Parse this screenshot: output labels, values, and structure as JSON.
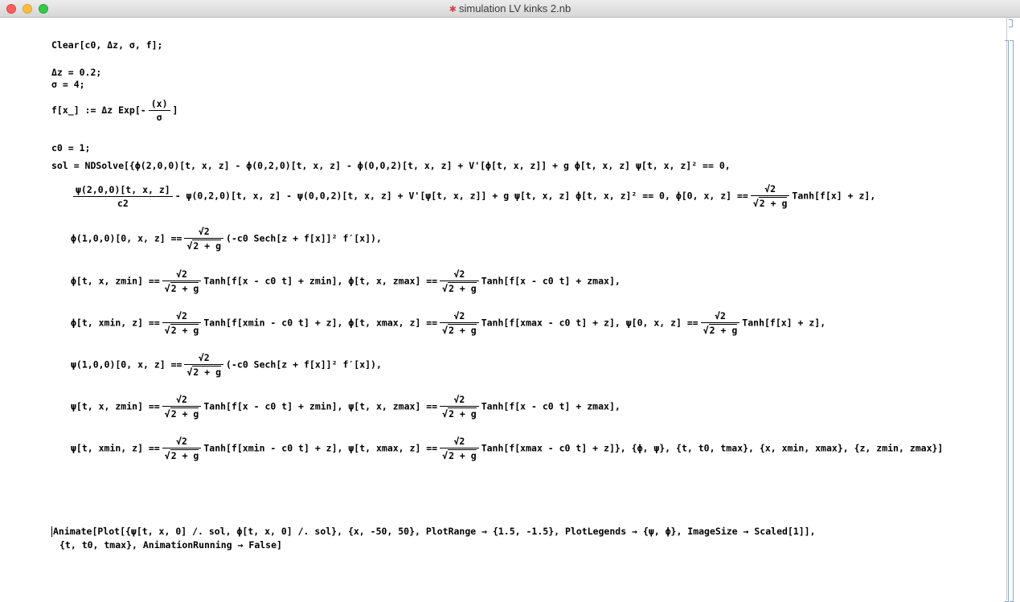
{
  "window": {
    "title": "simulation LV kinks 2.nb"
  },
  "lines": {
    "l1": "Clear[c0, Δz, σ, f];",
    "l2": "Δz = 0.2;",
    "l3": "σ = 4;",
    "l4_pre": "f[x_] := Δz Exp[",
    "l4_num": "(x)",
    "l4_den": "σ",
    "l4_post": "]",
    "l5": "c0 = 1;",
    "l6": "sol = NDSolve[{ϕ(2,0,0)[t, x, z] - ϕ(0,2,0)[t, x, z] - ϕ(0,0,2)[t, x, z] + V'[ϕ[t, x, z]] + g ϕ[t, x, z] ψ[t, x, z]² == 0,",
    "l7_num": "ψ(2,0,0)[t, x, z]",
    "l7_den": "c2",
    "l7_mid": "- ψ(0,2,0)[t, x, z] - ψ(0,0,2)[t, x, z] + V'[ψ[t, x, z]] + g ψ[t, x, z] ϕ[t, x, z]² == 0, ϕ[0, x, z] ==",
    "l7_post": "Tanh[f[x] + z],",
    "l8_pre": "ϕ(1,0,0)[0, x, z] ==",
    "l8_post": "(-c0 Sech[z + f[x]]² f′[x]),",
    "l9_a": "ϕ[t, x, zmin] ==",
    "l9_b": "Tanh[f[x - c0 t] + zmin], ϕ[t, x, zmax] ==",
    "l9_c": "Tanh[f[x - c0 t] + zmax],",
    "l10_a": "ϕ[t, xmin, z] ==",
    "l10_b": "Tanh[f[xmin - c0 t] + z], ϕ[t, xmax, z] ==",
    "l10_c": "Tanh[f[xmax - c0 t] + z], ψ[0, x, z] ==",
    "l10_d": "Tanh[f[x] + z],",
    "l11_pre": "ψ(1,0,0)[0, x, z] ==",
    "l11_post": "(-c0 Sech[z + f[x]]² f′[x]),",
    "l12_a": "ψ[t, x, zmin] ==",
    "l12_b": "Tanh[f[x - c0 t] + zmin], ψ[t, x, zmax] ==",
    "l12_c": "Tanh[f[x - c0 t] + zmax],",
    "l13_a": "ψ[t, xmin, z] ==",
    "l13_b": "Tanh[f[xmin - c0 t] + z], ψ[t, xmax, z] ==",
    "l13_c": "Tanh[f[xmax - c0 t] + z]}, {ϕ, ψ}, {t, t0, tmax}, {x, xmin, xmax}, {z, zmin, zmax}]",
    "sqrt_num": "√2",
    "sqrt_den": "2 + g",
    "a1": "Animate[Plot[{ψ[t, x, 0] /. sol, ϕ[t, x, 0] /. sol}, {x, -50, 50}, PlotRange → {1.5, -1.5}, PlotLegends → {ψ, ϕ}, ImageSize → Scaled[1]],",
    "a2": "{t, t0, tmax}, AnimationRunning → False]"
  }
}
